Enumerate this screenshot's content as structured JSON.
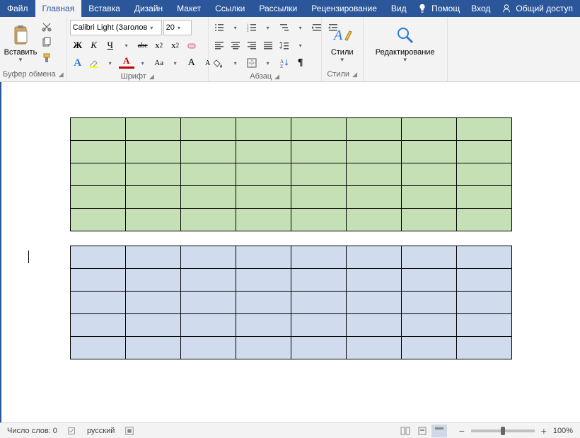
{
  "menubar": {
    "tabs": [
      "Файл",
      "Главная",
      "Вставка",
      "Дизайн",
      "Макет",
      "Ссылки",
      "Рассылки",
      "Рецензирование",
      "Вид"
    ],
    "active_index": 1,
    "help": "Помощ",
    "signin": "Вход",
    "share": "Общий доступ"
  },
  "ribbon": {
    "clipboard": {
      "label": "Буфер обмена",
      "paste": "Вставить"
    },
    "font": {
      "label": "Шрифт",
      "name": "Calibri Light (Заголов",
      "size": "20",
      "bold": "Ж",
      "italic": "К",
      "underline": "Ч",
      "strike": "abc",
      "sub": "x",
      "sup": "x",
      "clear": " ",
      "effects": " ",
      "highlight": " ",
      "color": "A",
      "case": "Aa",
      "grow": "A",
      "shrink": "A"
    },
    "paragraph": {
      "label": "Абзац"
    },
    "styles": {
      "label": "Стили",
      "button": "Стили"
    },
    "editing": {
      "label": "Редактирование"
    }
  },
  "document": {
    "table1": {
      "rows": 5,
      "cols": 8,
      "fill": "#c5e0b4"
    },
    "table2": {
      "rows": 5,
      "cols": 8,
      "fill": "#d0dbed"
    }
  },
  "statusbar": {
    "word_count": "Число слов: 0",
    "language": "русский",
    "zoom": "100%"
  }
}
